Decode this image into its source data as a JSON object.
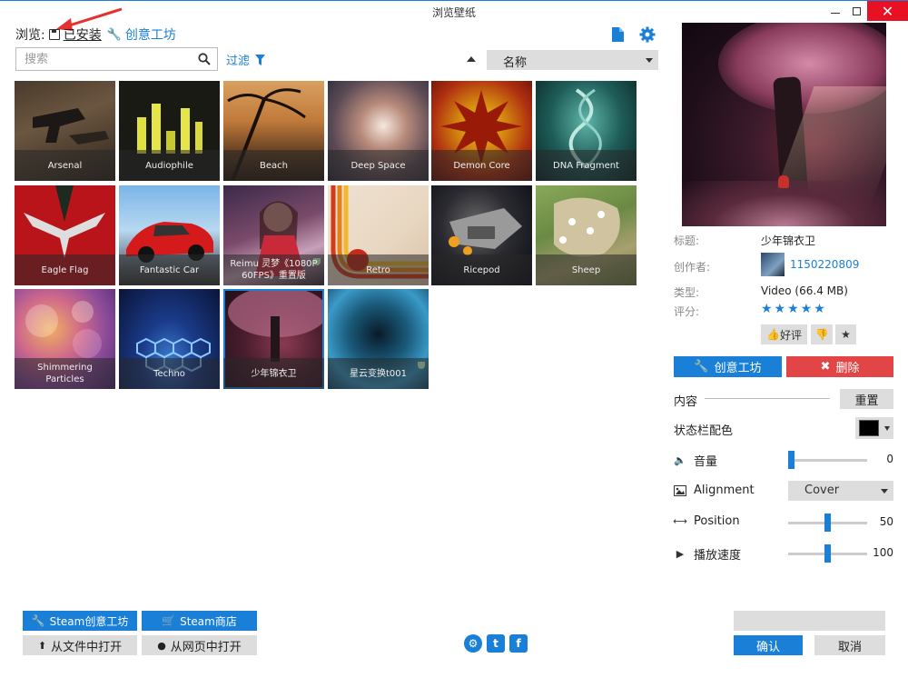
{
  "window": {
    "title": "浏览壁纸",
    "min_label": "",
    "close_label": "✕"
  },
  "browse": {
    "label": "浏览:",
    "installed": "已安装",
    "workshop": "创意工坊"
  },
  "search": {
    "placeholder": "搜索"
  },
  "filter": {
    "label": "过滤"
  },
  "sort": {
    "selected": "名称"
  },
  "wallpapers": [
    {
      "name": "Arsenal"
    },
    {
      "name": "Audiophile"
    },
    {
      "name": "Beach"
    },
    {
      "name": "Deep Space"
    },
    {
      "name": "Demon Core"
    },
    {
      "name": "DNA Fragment"
    },
    {
      "name": "Eagle Flag"
    },
    {
      "name": "Fantastic Car"
    },
    {
      "name": "Reimu 灵梦《1080P 60FPS》重置版"
    },
    {
      "name": "Retro"
    },
    {
      "name": "Ricepod"
    },
    {
      "name": "Sheep"
    },
    {
      "name": "Shimmering Particles"
    },
    {
      "name": "Techno"
    },
    {
      "name": "少年锦衣卫"
    },
    {
      "name": "星云变换t001"
    }
  ],
  "details": {
    "title_key": "标题:",
    "title_value": "少年锦衣卫",
    "author_key": "创作者:",
    "author_value": "1150220809",
    "type_key": "类型:",
    "type_value": "Video (66.4 MB)",
    "rating_key": "评分:",
    "stars": "★★★★★",
    "like_label": "好评"
  },
  "actions": {
    "workshop": "创意工坊",
    "delete": "删除"
  },
  "properties": {
    "content_label": "内容",
    "reset_label": "重置",
    "status_color_label": "状态栏配色",
    "status_color": "#000000",
    "volume_label": "音量",
    "volume_value": "0",
    "alignment_label": "Alignment",
    "alignment_value": "Cover",
    "position_label": "Position",
    "position_value": "50",
    "speed_label": "播放速度",
    "speed_value": "100"
  },
  "bottom": {
    "steam_workshop": "Steam创意工坊",
    "steam_store": "Steam商店",
    "open_file": "从文件中打开",
    "open_web": "从网页中打开",
    "ok": "确认",
    "cancel": "取消"
  },
  "colors": {
    "accent": "#1a7fd6",
    "danger": "#e14545"
  }
}
